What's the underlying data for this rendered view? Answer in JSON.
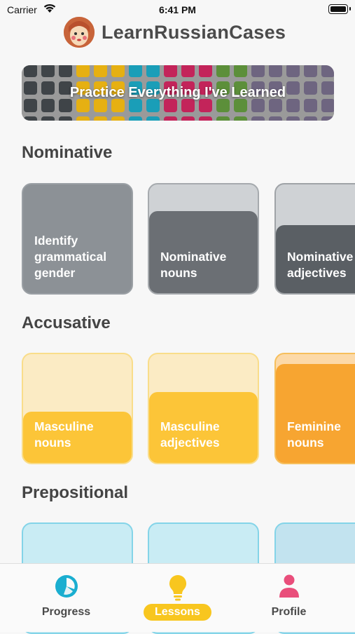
{
  "status_bar": {
    "carrier": "Carrier",
    "time": "6:41 PM"
  },
  "header": {
    "title": "LearnRussianCases"
  },
  "banner": {
    "label": "Practice Everything I've Learned"
  },
  "sections": [
    {
      "title": "Nominative",
      "cards": [
        {
          "label": "Identify\ngrammatical\ngender"
        },
        {
          "label": "Nominative\nnouns"
        },
        {
          "label": "Nominative\nadjectives"
        }
      ]
    },
    {
      "title": "Accusative",
      "cards": [
        {
          "label": "Masculine\nnouns"
        },
        {
          "label": "Masculine\nadjectives"
        },
        {
          "label": "Feminine\nnouns"
        }
      ]
    },
    {
      "title": "Prepositional",
      "cards": [
        {
          "label": ""
        },
        {
          "label": ""
        },
        {
          "label": ""
        }
      ]
    }
  ],
  "tabbar": {
    "tabs": [
      {
        "label": "Progress",
        "icon": "pie-chart-icon",
        "active": false
      },
      {
        "label": "Lessons",
        "icon": "lightbulb-icon",
        "active": true
      },
      {
        "label": "Profile",
        "icon": "person-icon",
        "active": false
      }
    ]
  },
  "colors": {
    "nominative": "#8c9196",
    "accusative": "#fcc538",
    "prepositional": "#84d4e8",
    "progress_icon": "#1aaed0",
    "lessons_icon": "#f8c61f",
    "profile_icon": "#e94e7b"
  }
}
